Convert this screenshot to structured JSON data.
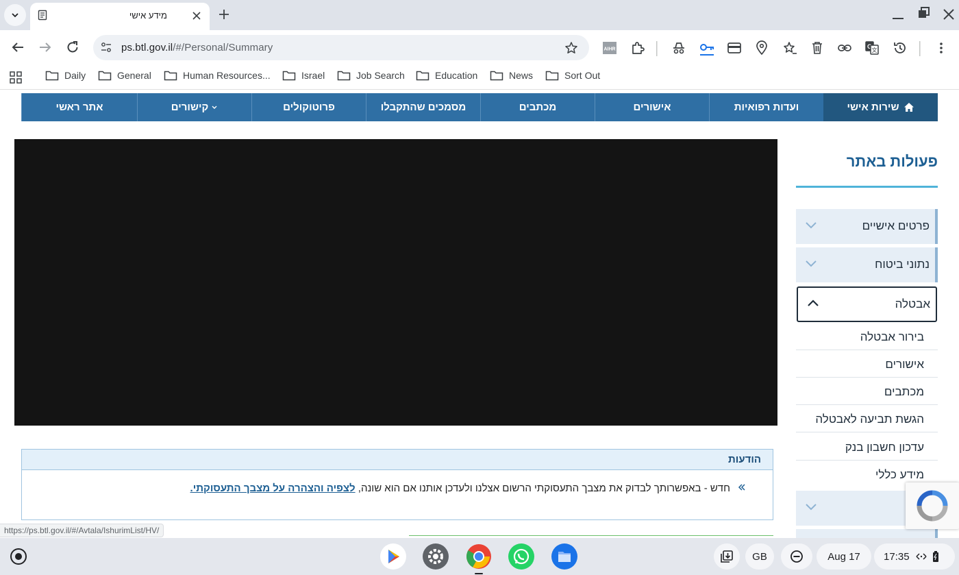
{
  "browser": {
    "tab": {
      "title": "מידע אישי"
    },
    "url": {
      "host": "ps.btl.gov.il",
      "path": "/#/Personal/Summary"
    },
    "bookmarks": [
      "Daily",
      "General",
      "Human Resources...",
      "Israel",
      "Job Search",
      "Education",
      "News",
      "Sort Out"
    ],
    "extensions": [
      "aihr-icon",
      "puzzle-icon",
      "incognito-icon",
      "key-icon",
      "card-icon",
      "location-pin-icon",
      "star-list-icon",
      "trash-icon",
      "link-icon",
      "translate-icon",
      "history-icon",
      "menu-dots-icon"
    ],
    "status_url": "https://ps.btl.gov.il/#/Avtala/IshurimList/HV/"
  },
  "site": {
    "topnav": [
      {
        "label": "שירות אישי",
        "active": true,
        "icon": "home-icon"
      },
      {
        "label": "ועדות רפואיות"
      },
      {
        "label": "אישורים"
      },
      {
        "label": "מכתבים"
      },
      {
        "label": "מסמכים שהתקבלו"
      },
      {
        "label": "פרוטוקולים"
      },
      {
        "label": "קישורים",
        "dropdown": true
      },
      {
        "label": "אתר ראשי"
      }
    ],
    "sidebar": {
      "title": "פעולות באתר",
      "sections": [
        {
          "label": "פרטים אישיים"
        },
        {
          "label": "נתוני ביטוח"
        },
        {
          "label": "אבטלה",
          "open": true
        }
      ],
      "subitems": [
        "בירור אבטלה",
        "אישורים",
        "מכתבים",
        "הגשת תביעה לאבטלה",
        "עדכון חשבון בנק",
        "מידע כללי"
      ]
    },
    "notices": {
      "title": "הודעות",
      "text": "חדש - באפשרותך לבדוק את מצבך התעסוקתי הרשום אצלנו ולעדכן אותנו אם הוא שונה,",
      "link": "לצפיה והצהרה על מצבך התעסוקתי."
    }
  },
  "shelf": {
    "apps": [
      "play-store-icon",
      "settings-icon",
      "chrome-icon",
      "whatsapp-icon",
      "files-icon"
    ],
    "keyboard": "GB",
    "date": "Aug 17",
    "time": "17:35"
  }
}
